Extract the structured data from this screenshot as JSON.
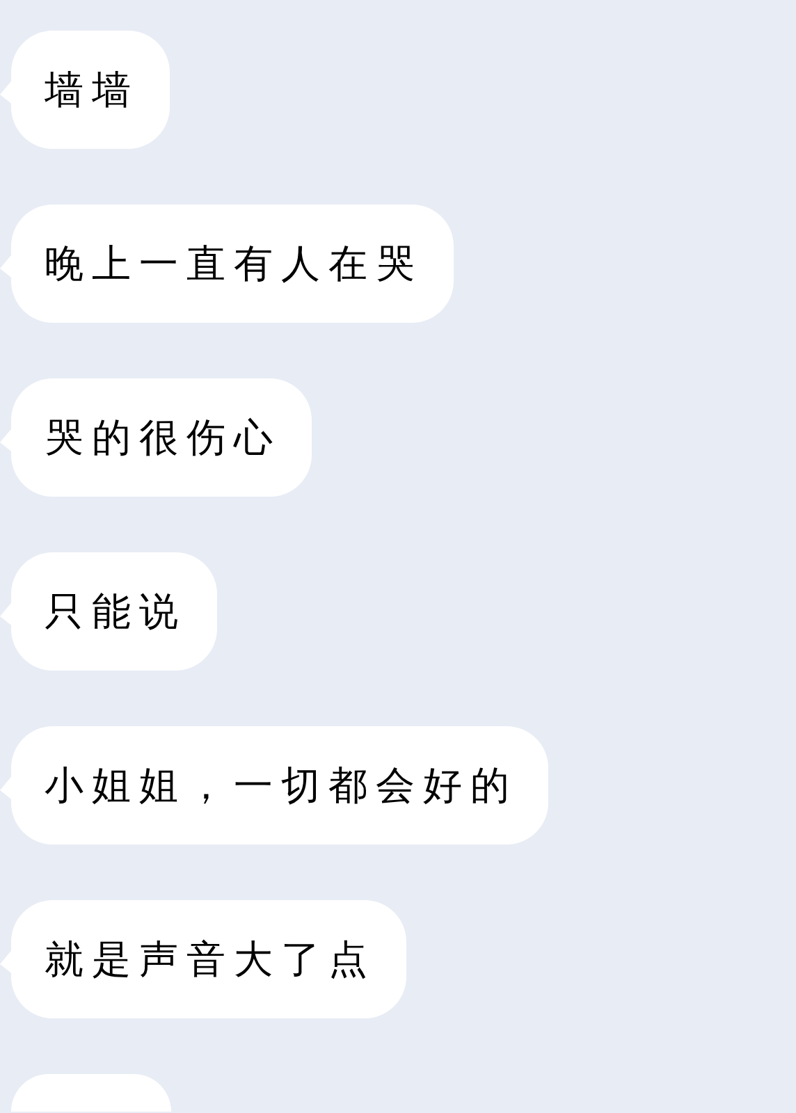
{
  "messages": [
    {
      "kind": "text",
      "text": "墙墙"
    },
    {
      "kind": "text",
      "text": "晚上一直有人在哭"
    },
    {
      "kind": "text",
      "text": "哭的很伤心"
    },
    {
      "kind": "text",
      "text": "只能说"
    },
    {
      "kind": "text",
      "text": "小姐姐，一切都会好的"
    },
    {
      "kind": "text",
      "text": "就是声音大了点"
    },
    {
      "kind": "partial"
    }
  ]
}
